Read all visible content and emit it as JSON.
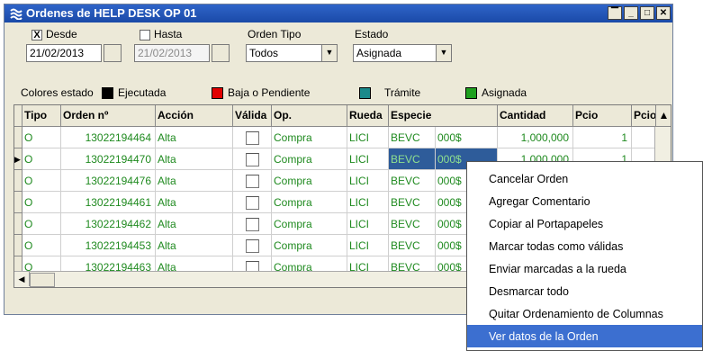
{
  "window": {
    "title": "Ordenes de HELP DESK OP 01"
  },
  "filters": {
    "desde": {
      "label": "Desde",
      "checked": true,
      "checkmark": "X",
      "value": "21/02/2013"
    },
    "hasta": {
      "label": "Hasta",
      "checked": false,
      "value": "21/02/2013"
    },
    "orden_tipo": {
      "label": "Orden Tipo",
      "selected": "Todos"
    },
    "estado": {
      "label": "Estado",
      "selected": "Asignada"
    }
  },
  "legend": {
    "title": "Colores estado",
    "items": [
      {
        "label": "Ejecutada",
        "color": "#000000"
      },
      {
        "label": "Baja o Pendiente",
        "color": "#e00000"
      },
      {
        "label": "Trámite",
        "color": "#1a8a8a"
      },
      {
        "label": "Asignada",
        "color": "#1fa01f"
      }
    ]
  },
  "table": {
    "columns": [
      "Tipo",
      "Orden nº",
      "Acción",
      "Válida",
      "Op.",
      "Rueda",
      "Especie",
      "Cantidad",
      "Pcio",
      "Pcio"
    ],
    "rows": [
      [
        "O",
        "13022194464",
        "Alta",
        "",
        "Compra",
        "LICI",
        "BEVC",
        "000$",
        "1,000,000",
        "1"
      ],
      [
        "O",
        "13022194470",
        "Alta",
        "",
        "Compra",
        "LICI",
        "BEVC",
        "000$",
        "1,000,000",
        "1"
      ],
      [
        "O",
        "13022194476",
        "Alta",
        "",
        "Compra",
        "LICI",
        "BEVC",
        "000$",
        "",
        ""
      ],
      [
        "O",
        "13022194461",
        "Alta",
        "",
        "Compra",
        "LICI",
        "BEVC",
        "000$",
        "",
        ""
      ],
      [
        "O",
        "13022194462",
        "Alta",
        "",
        "Compra",
        "LICI",
        "BEVC",
        "000$",
        "",
        ""
      ],
      [
        "O",
        "13022194453",
        "Alta",
        "",
        "Compra",
        "LICI",
        "BEVC",
        "000$",
        "",
        ""
      ],
      [
        "O",
        "13022194463",
        "Alta",
        "",
        "Compra",
        "LICI",
        "BEVC",
        "000$",
        "",
        ""
      ]
    ],
    "row_color": "#1f8a1f"
  },
  "context_menu": {
    "items": [
      "Cancelar Orden",
      "Agregar Comentario",
      "Copiar al Portapapeles",
      "Marcar todas como válidas",
      "Enviar marcadas a la rueda",
      "Desmarcar todo",
      "Quitar Ordenamiento de Columnas",
      "Ver datos de la Orden"
    ],
    "highlighted": "Ver datos de la Orden"
  }
}
